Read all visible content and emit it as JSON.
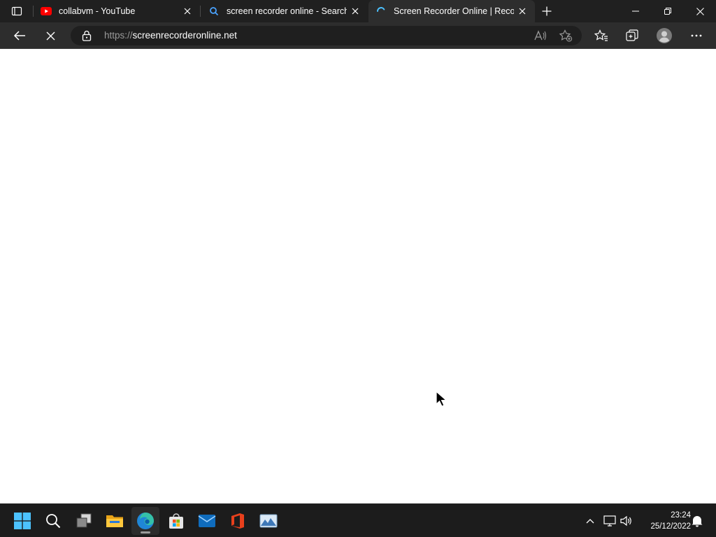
{
  "browser": {
    "tabs": [
      {
        "title": "collabvm - YouTube",
        "favicon": "youtube-icon",
        "active": false
      },
      {
        "title": "screen recorder online - Search",
        "favicon": "search-icon",
        "active": false
      },
      {
        "title": "Screen Recorder Online | Record",
        "favicon": "loading-spinner-icon",
        "active": true
      }
    ],
    "address": {
      "scheme": "https://",
      "host": "screenrecorderonline.net"
    },
    "status": "loading"
  },
  "taskbar": {
    "apps": [
      {
        "name": "start",
        "icon": "windows-logo-icon"
      },
      {
        "name": "search",
        "icon": "search-icon"
      },
      {
        "name": "task-view",
        "icon": "task-view-icon"
      },
      {
        "name": "file-explorer",
        "icon": "folder-icon"
      },
      {
        "name": "edge",
        "icon": "edge-icon",
        "active": true
      },
      {
        "name": "store",
        "icon": "store-icon"
      },
      {
        "name": "mail",
        "icon": "mail-icon"
      },
      {
        "name": "office",
        "icon": "office-icon"
      },
      {
        "name": "photos",
        "icon": "photos-icon"
      }
    ],
    "clock": {
      "time": "23:24",
      "date": "25/12/2022"
    }
  },
  "colors": {
    "titlebar": "#202020",
    "toolbar": "#2d2d2d",
    "taskbar": "#1c1c1c",
    "accent": "#4cc2ff",
    "youtube": "#ff0000"
  }
}
